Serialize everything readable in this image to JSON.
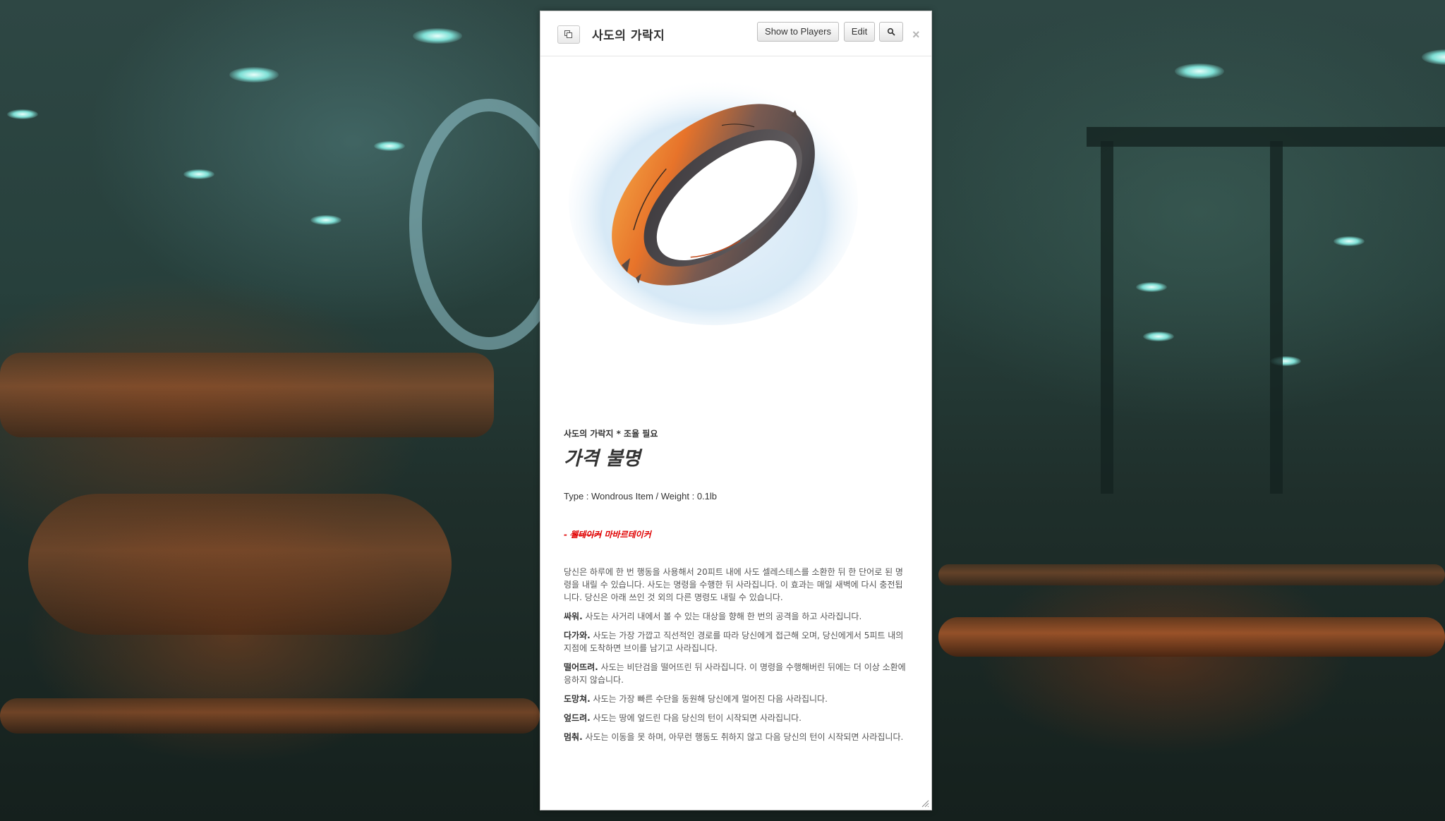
{
  "dialog": {
    "title": "사도의 가락지",
    "show_to_players_label": "Show to Players",
    "edit_label": "Edit",
    "search_icon": "magnifier-icon",
    "close_label": "×",
    "popout_icon": "popout-icon"
  },
  "item": {
    "name_line": "사도의 가락지 * 조율 필요",
    "price": "가격 불명",
    "type_line": "Type : Wondrous Item / Weight : 0.1lb",
    "owner_prefix": "- ",
    "owner_struck": "웰테이커",
    "owner_name": " 마바르테이커",
    "image_icon": "ring-image",
    "description_intro": "당신은 하루에 한 번 행동을 사용해서 20피트 내에 사도 셀레스테스를 소환한 뒤 한 단어로 된 명령을 내릴 수 있습니다. 사도는 명령을 수행한 뒤 사라집니다. 이 효과는 매일 새벽에 다시 충전됩니다. 당신은 아래 쓰인 것 외의 다른 명령도 내릴 수 있습니다.",
    "commands": [
      {
        "term": "싸워.",
        "text": " 사도는 사거리 내에서 볼 수 있는 대상을 향해 한 번의 공격을 하고 사라집니다."
      },
      {
        "term": "다가와.",
        "text": " 사도는 가장 가깝고 직선적인 경로를 따라 당신에게 접근해 오며, 당신에게서 5피트 내의 지점에 도착하면 브이를 남기고 사라집니다."
      },
      {
        "term": "떨어뜨려.",
        "text": " 사도는 비단검을 떨어뜨린 뒤 사라집니다. 이 명령을 수행해버린 뒤에는 더 이상 소환에 응하지 않습니다."
      },
      {
        "term": "도망쳐.",
        "text": " 사도는 가장 빠른 수단을 동원해 당신에게 멀어진 다음 사라집니다."
      },
      {
        "term": "엎드려.",
        "text": " 사도는 땅에 엎드린 다음 당신의 턴이 시작되면 사라집니다."
      },
      {
        "term": "멈춰.",
        "text": " 사도는 이동을 못 하며, 아무런 행동도 취하지 않고 다음 당신의 턴이 시작되면 사라집니다."
      }
    ]
  }
}
